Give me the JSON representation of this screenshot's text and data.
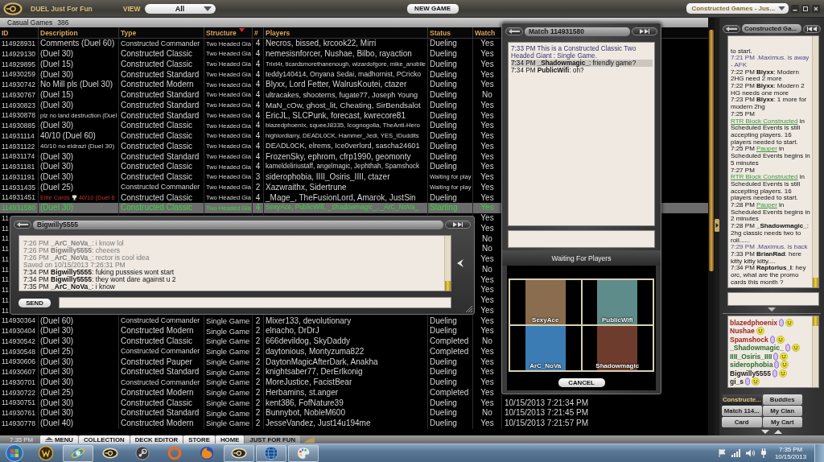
{
  "top_bar": {
    "title": "DUEL Just For Fun",
    "view_label": "VIEW",
    "view": "All",
    "new_game": "NEW GAME",
    "channel": "Constructed Games - Jus..."
  },
  "games": {
    "title": "Casual Games",
    "count": "386",
    "columns": [
      {
        "label": "ID",
        "sorted": false
      },
      {
        "label": "Description",
        "sorted": false
      },
      {
        "label": "Type",
        "sorted": false
      },
      {
        "label": "Structure",
        "sorted": true
      },
      {
        "label": "#",
        "sorted": false
      },
      {
        "label": "Players",
        "sorted": false
      },
      {
        "label": "Status",
        "sorted": false
      },
      {
        "label": "Watch",
        "sorted": false
      }
    ],
    "rows": [
      {
        "id": "114928931",
        "description": "Comments (Duel 60)",
        "type": "Constructed Commander",
        "structure": "Two Headed Gia",
        "num": "4",
        "players": "Necros, bissed, krcook22, Mirri",
        "status": "Dueling",
        "watch": "Yes",
        "selected": false
      },
      {
        "id": "114929130",
        "description": "(Duel 30)",
        "type": "Constructed Classic",
        "structure": "Two Headed Gia",
        "num": "4",
        "players": "nemesisnforcer, Nushae, Bilbo, rayaction",
        "status": "Dueling",
        "watch": "Yes",
        "selected": false
      },
      {
        "id": "114929895",
        "description": "(Duel 15)",
        "type": "Constructed Classic",
        "structure": "Two Headed Gia",
        "num": "4",
        "players": "Trixt4r, ticardsmorethanenough, wizardofgore, mike_anobile",
        "status": "Dueling",
        "watch": "Yes",
        "selected": false
      },
      {
        "id": "114930259",
        "description": "(Duel 30)",
        "type": "Constructed Standard",
        "structure": "Two Headed Gia",
        "num": "4",
        "players": "teddy140414, Onyana Sedai, madhornist, PCricko",
        "status": "Dueling",
        "watch": "Yes",
        "selected": false
      },
      {
        "id": "114930742",
        "description": "No Mill pls (Duel 30)",
        "type": "Constructed Modern",
        "structure": "Two Headed Gia",
        "num": "4",
        "players": "Blyxx, Lord Fetter, WalrusKoutei, ctazer",
        "status": "Dueling",
        "watch": "Yes",
        "selected": false
      },
      {
        "id": "114930767",
        "description": "(Duel 15)",
        "type": "Constructed Standard",
        "structure": "Two Headed Gia",
        "num": "4",
        "players": "ultracakes, shooterns, fugate77, Joseph Young",
        "status": "Dueling",
        "watch": "No",
        "selected": false
      },
      {
        "id": "114930823",
        "description": "(Duel 30)",
        "type": "Constructed Standard",
        "structure": "Two Headed Gia",
        "num": "4",
        "players": "MaN_cOw, ghost_lit, Cheating, SirBendsalot",
        "status": "Dueling",
        "watch": "Yes",
        "selected": false
      },
      {
        "id": "114930878",
        "description": "plz no land destruction (Duel",
        "type": "Constructed Standard",
        "structure": "Two Headed Gia",
        "num": "4",
        "players": "EricJL, SLCPunk, forecast, kwrecore81",
        "status": "Dueling",
        "watch": "Yes",
        "selected": false
      },
      {
        "id": "114930885",
        "description": "(Duel 30)",
        "type": "Constructed Classic",
        "structure": "Two Headed Gia",
        "num": "4",
        "players": "blazedphoenix, squeeJ8335, Icognogolia, TheAnti-Hero",
        "status": "Dueling",
        "watch": "Yes",
        "selected": false
      },
      {
        "id": "114931114",
        "description": "40/10 (Duel 60)",
        "type": "Constructed Classic",
        "structure": "Two Headed Gia",
        "num": "4",
        "players": "highlordlarry, DEADL0CK, Hammer_Jedi, YES_IDuddits",
        "status": "Dueling",
        "watch": "Yes",
        "selected": false
      },
      {
        "id": "114931122",
        "description": "40/10 no eldrazi (Duel 30)",
        "type": "Constructed Classic",
        "structure": "Two Headed Gia",
        "num": "4",
        "players": "DEADL0CK, elrems, Ice0verlord, sascha24601",
        "status": "Dueling",
        "watch": "Yes",
        "selected": false
      },
      {
        "id": "114931174",
        "description": "(Duel 30)",
        "type": "Constructed Standard",
        "structure": "Two Headed Gia",
        "num": "4",
        "players": "FrozenSky, ephrom, cfrp1990, geomonty",
        "status": "Dueling",
        "watch": "Yes",
        "selected": false
      },
      {
        "id": "114931181",
        "description": "(Duel 30)",
        "type": "Constructed Classic",
        "structure": "Two Headed Gia",
        "num": "4",
        "players": "kameldeliriustaff, angelmagic, Jephthah, Spamshock",
        "status": "Dueling",
        "watch": "Yes",
        "selected": false
      },
      {
        "id": "114931191",
        "description": "(Duel 30)",
        "type": "Constructed Classic",
        "structure": "Two Headed Gia",
        "num": "3",
        "players": "siderophobia, IIII_Osiris_IIII, ctazer",
        "status": "Waiting for play",
        "watch": "Yes",
        "selected": false
      },
      {
        "id": "114931435",
        "description": "(Duel 25)",
        "type": "Constructed Commander",
        "structure": "Two Headed Gia",
        "num": "2",
        "players": "Xazwraithx, Sidertrune",
        "status": "Waiting for play",
        "watch": "Yes",
        "selected": false
      },
      {
        "id": "114931451",
        "tag": "Elite Cards",
        "description": "40/10 (Duel 6",
        "type": "Constructed Classic",
        "structure": "Two Headed Gia",
        "num": "4",
        "players": "_Mage_, TheFusionLord, Amarok, JustSin",
        "status": "Dueling",
        "watch": "Yes",
        "selected": false
      },
      {
        "id": "114931580",
        "description": "(Duel 30)",
        "type": "Constructed Classic",
        "structure": "Two Headed Gia",
        "num": "4",
        "players": "SexyAce, PublicWifi, _Shadowmagic_, _ArC_NoVa_",
        "status": "Starting",
        "watch": "Yes",
        "selected": true
      },
      {
        "id": "11",
        "watch": "Yes",
        "selected": false
      },
      {
        "id": "11",
        "watch": "Yes",
        "selected": false
      },
      {
        "id": "11",
        "watch": "No",
        "selected": false
      },
      {
        "id": "11",
        "watch": "No",
        "selected": false
      },
      {
        "id": "11",
        "watch": "Yes",
        "selected": false
      },
      {
        "id": "11",
        "watch": "No",
        "selected": false
      },
      {
        "id": "11",
        "watch": "Yes",
        "selected": false
      },
      {
        "id": "11",
        "watch": "Yes",
        "selected": false
      },
      {
        "id": "11",
        "watch": "Yes",
        "selected": false
      },
      {
        "id": "11",
        "watch": "Yes",
        "selected": false
      },
      {
        "id": "114930364",
        "description": "(Duel 60)",
        "type": "Constructed Commander",
        "structure": "Single Game",
        "num": "2",
        "players": "Mixer133, devolutionary",
        "status": "Dueling",
        "watch": "Yes",
        "selected": false
      },
      {
        "id": "114930404",
        "description": "(Duel 30)",
        "type": "Constructed Modern",
        "structure": "Single Game",
        "num": "2",
        "players": "elnacho, DrDrJ",
        "status": "Dueling",
        "watch": "Yes",
        "selected": false
      },
      {
        "id": "114930542",
        "description": "(Duel 30)",
        "type": "Constructed Classic",
        "structure": "Single Game",
        "num": "2",
        "players": "666devildog, SkyDaddy",
        "status": "Completed",
        "watch": "No",
        "selected": false
      },
      {
        "id": "114930548",
        "description": "(Duel 25)",
        "type": "Constructed Commander",
        "structure": "Single Game",
        "num": "2",
        "players": "daytonious, Montyzuma822",
        "status": "Completed",
        "watch": "Yes",
        "selected": false
      },
      {
        "id": "114930606",
        "description": "(Duel 30)",
        "type": "Constructed Pauper",
        "structure": "Single Game",
        "num": "2",
        "players": "DaytonMagicAfterDark, Anakha",
        "status": "Dueling",
        "watch": "Yes",
        "selected": false
      },
      {
        "id": "114930607",
        "description": "(Duel 30)",
        "type": "Constructed Standard",
        "structure": "Single Game",
        "num": "2",
        "players": "knightsaber77, DerErlkonig",
        "status": "Dueling",
        "watch": "Yes",
        "selected": false
      },
      {
        "id": "114930701",
        "description": "(Duel 30)",
        "type": "Constructed Commander",
        "structure": "Single Game",
        "num": "2",
        "players": "MoreJustice, FacistBear",
        "status": "Dueling",
        "watch": "Yes",
        "selected": false
      },
      {
        "id": "114930722",
        "description": "(Duel 25)",
        "type": "Constructed Modern",
        "structure": "Single Game",
        "num": "2",
        "players": "Herbamins, st.anger",
        "status": "Completed",
        "watch": "Yes",
        "selected": false
      },
      {
        "id": "114930751",
        "description": "(Duel 30)",
        "type": "Constructed Classic",
        "structure": "Single Game",
        "num": "2",
        "players": "kent386, FofNature39",
        "status": "Dueling",
        "watch": "Yes",
        "column_9": "10/15/2013 7:21:34 PM",
        "selected": false
      },
      {
        "id": "114930761",
        "description": "(Duel 30)",
        "type": "Constructed Standard",
        "structure": "Single Game",
        "num": "2",
        "players": "Bunnybot, NobleM600",
        "status": "Dueling",
        "watch": "No",
        "column_9": "10/15/2013 7:21:45 PM",
        "selected": false
      },
      {
        "id": "114930778",
        "description": "(Duel 40)",
        "type": "Constructed Modern",
        "structure": "Single Game",
        "num": "2",
        "players": "JesseVandez, Just14u194me",
        "status": "Dueling",
        "watch": "Yes",
        "column_9": "10/15/2013 7:21:57 PM",
        "selected": false
      }
    ]
  },
  "private_chat": {
    "title": "Bigwilly5555",
    "messages": [
      {
        "old": true,
        "text": "7:26 PM **_ArC_NoVa_**: i know lol"
      },
      {
        "old": true,
        "text": "7:26 PM **Bigwilly5555**: cheeers"
      },
      {
        "old": true,
        "text": "7:26 PM **_ArC_NoVa_**: rector is cool idea"
      },
      {
        "old": true,
        "text": "Saved on 10/15/2013 7:26:31 PM"
      },
      {
        "old": false,
        "text": "7:34 PM **Bigwilly5555**: fuking pusssies wont start"
      },
      {
        "old": false,
        "text": "7:34 PM **Bigwilly5555**: they wont dare against u 2"
      },
      {
        "old": false,
        "text": "7:35 PM **_ArC_NoVa_**: i know"
      }
    ],
    "send": "SEND"
  },
  "match": {
    "title": "Match 114931580",
    "messages": [
      {
        "kind": "system",
        "highlighted": false,
        "text": "7:33 PM This is a Constructed Classic Two Headed Giant : Single Game."
      },
      {
        "kind": "chat",
        "highlighted": true,
        "text": "7:34 PM **_Shadowmagic_**: friendly game?"
      },
      {
        "kind": "chat",
        "highlighted": false,
        "text": "7:34 PM **PublicWifi**: oh?"
      }
    ],
    "status": "Waiting For Players",
    "players": [
      {
        "name": "SexyAce",
        "color": "#8a6c4e"
      },
      {
        "name": "PublicWifi",
        "color": "#5e8c8a"
      },
      {
        "name": "ArC_NoVa",
        "color": "#3c7cb4"
      },
      {
        "name": "Shadowmagic",
        "color": "#6e3c2c"
      }
    ],
    "cancel": "CANCEL"
  },
  "lobby_chat": {
    "title": "Constructed Ga...",
    "messages": [
      {
        "kind": "chat",
        "text": "to start."
      },
      {
        "kind": "notice",
        "text": "7:21 PM .Maximus. is away - AFK"
      },
      {
        "kind": "chat",
        "text": "7:22 PM **Blyxx**: Modern 2HG need 2 more"
      },
      {
        "kind": "chat",
        "text": "7:22 PM **Blyxx**: Modern 2 HG needs one more"
      },
      {
        "kind": "chat",
        "text": "7:23 PM **Blyxx**: 1 more for modern 2hg"
      },
      {
        "kind": "event",
        "time": "7:25 PM",
        "link": "RTR Block Constructed",
        "text": "in Scheduled Events is still accepting players. 16 players needed to start."
      },
      {
        "kind": "event",
        "time": "7:25 PM",
        "link": "Pauper",
        "text": "in Scheduled Events begins in 5 minutes"
      },
      {
        "kind": "event",
        "time": "7:27 PM",
        "link": "RTR Block Constructed",
        "text": "in Scheduled Events is still accepting players. 16 players needed to start."
      },
      {
        "kind": "event",
        "time": "7:28 PM",
        "link": "Pauper",
        "text": "in Scheduled Events begins in 2 minutes"
      },
      {
        "kind": "chat",
        "text": "7:28 PM **_Shadowmagic_**: 2hg classic needs two to roll......"
      },
      {
        "kind": "notice",
        "text": "7:29 PM .Maximus. is back"
      },
      {
        "kind": "chat",
        "text": "7:33 PM **BrianRad**: here kitty kitty kitty...."
      },
      {
        "kind": "chat",
        "text": "7:34 PM **Raptorius_I**: hey orc, what are the promo cards this month ?"
      }
    ],
    "users": [
      {
        "name": "blazedphoenix",
        "color": "#9c2222",
        "badge": true
      },
      {
        "name": "Nushae",
        "color": "#9c2222",
        "badge": false
      },
      {
        "name": "Spamshock",
        "color": "#9c2222",
        "badge": true
      },
      {
        "name": "_Shadowmagic_",
        "color": "#2c6c2c",
        "badge": true
      },
      {
        "name": "IIII_Osiris_IIII",
        "color": "#2c6c2c",
        "badge": true
      },
      {
        "name": "siderophobia",
        "color": "#2c6c2c",
        "badge": true
      },
      {
        "name": "Bigwilly5555",
        "color": "#1c1c1c",
        "badge": true
      },
      {
        "name": "gi_s",
        "color": "#1c1c1c",
        "badge": true
      }
    ],
    "tabs": [
      {
        "label": "Constructe...",
        "selected": true
      },
      {
        "label": "Buddies",
        "selected": false
      },
      {
        "label": "Match 114...",
        "selected": false
      },
      {
        "label": "My Clan",
        "selected": false
      },
      {
        "label": "Card",
        "selected": false
      },
      {
        "label": "My Cart",
        "selected": false
      }
    ]
  },
  "nav": {
    "time": "7:35 PM",
    "tabs": [
      {
        "label": "MENU",
        "has_icon": true,
        "selected": false
      },
      {
        "label": "COLLECTION",
        "has_icon": false,
        "selected": false
      },
      {
        "label": "DECK EDITOR",
        "has_icon": false,
        "selected": false
      },
      {
        "label": "STORE",
        "has_icon": false,
        "selected": false
      },
      {
        "label": "HOME",
        "has_icon": false,
        "selected": false
      },
      {
        "label": "JUST FOR FUN",
        "has_icon": false,
        "selected": true
      }
    ]
  },
  "taskbar": {
    "apps": [
      {
        "kind": "emblem",
        "running": false
      },
      {
        "kind": "orbit",
        "running": true
      },
      {
        "kind": "ring-logo",
        "running": false
      },
      {
        "kind": "disc",
        "running": false
      },
      {
        "kind": "ring",
        "running": false
      },
      {
        "kind": "swirl",
        "running": false
      },
      {
        "kind": "ring-logo",
        "running": true
      },
      {
        "kind": "globe",
        "running": true
      },
      {
        "kind": "palette",
        "running": true
      }
    ],
    "time": "7:35 PM",
    "date": "10/15/2013"
  }
}
